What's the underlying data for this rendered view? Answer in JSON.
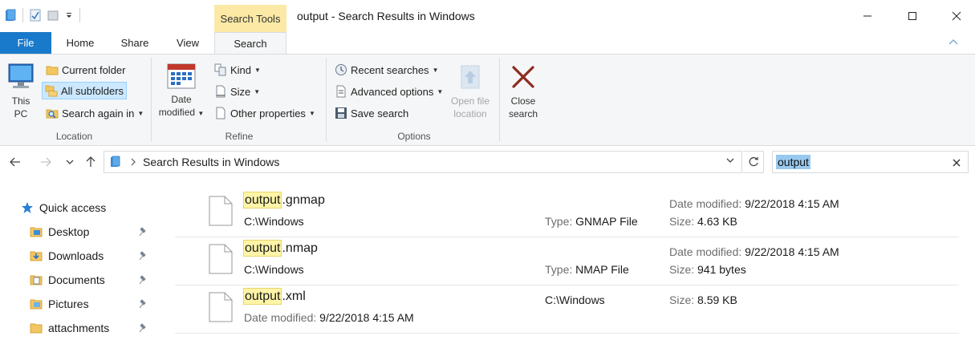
{
  "window": {
    "title": "output - Search Results in Windows",
    "context_tab": "Search Tools",
    "controls": [
      "minimize",
      "maximize",
      "close"
    ]
  },
  "tabs": [
    {
      "label": "File"
    },
    {
      "label": "Home"
    },
    {
      "label": "Share"
    },
    {
      "label": "View"
    },
    {
      "label": "Search",
      "active": true
    }
  ],
  "ribbon": {
    "location": {
      "label": "Location",
      "this_pc": "This PC",
      "current_folder": "Current folder",
      "all_subfolders": "All subfolders",
      "search_again_in": "Search again in"
    },
    "refine": {
      "label": "Refine",
      "date_modified": "Date modified",
      "kind": "Kind",
      "size": "Size",
      "other_properties": "Other properties"
    },
    "options": {
      "label": "Options",
      "recent_searches": "Recent searches",
      "advanced_options": "Advanced options",
      "save_search": "Save search",
      "open_file_location": "Open file location"
    },
    "close": {
      "close_search": "Close search"
    }
  },
  "address": {
    "path": "Search Results in Windows",
    "search_value": "output"
  },
  "nav": {
    "quick_access": "Quick access",
    "items": [
      {
        "label": "Desktop",
        "icon": "desktop-folder-icon"
      },
      {
        "label": "Downloads",
        "icon": "downloads-folder-icon"
      },
      {
        "label": "Documents",
        "icon": "documents-folder-icon"
      },
      {
        "label": "Pictures",
        "icon": "pictures-folder-icon"
      },
      {
        "label": "attachments",
        "icon": "folder-icon"
      }
    ]
  },
  "results": [
    {
      "highlight": "output",
      "rest": ".gnmap",
      "path": "C:\\Windows",
      "type_key": "Type:",
      "type_val": "GNMAP File",
      "date_key": "Date modified:",
      "date_val": "9/22/2018 4:15 AM",
      "size_key": "Size:",
      "size_val": "4.63 KB"
    },
    {
      "highlight": "output",
      "rest": ".nmap",
      "path": "C:\\Windows",
      "type_key": "Type:",
      "type_val": "NMAP File",
      "date_key": "Date modified:",
      "date_val": "9/22/2018 4:15 AM",
      "size_key": "Size:",
      "size_val": "941 bytes"
    },
    {
      "highlight": "output",
      "rest": ".xml",
      "path": "C:\\Windows",
      "date_key": "Date modified:",
      "date_val": "9/22/2018 4:15 AM",
      "size_key": "Size:",
      "size_val": "8.59 KB"
    }
  ],
  "colors": {
    "accent": "#1979ca",
    "context_tab": "#fbe9a5",
    "highlight": "#fff5a8",
    "selected": "#cce8ff",
    "search_selection": "#99c9ef"
  }
}
